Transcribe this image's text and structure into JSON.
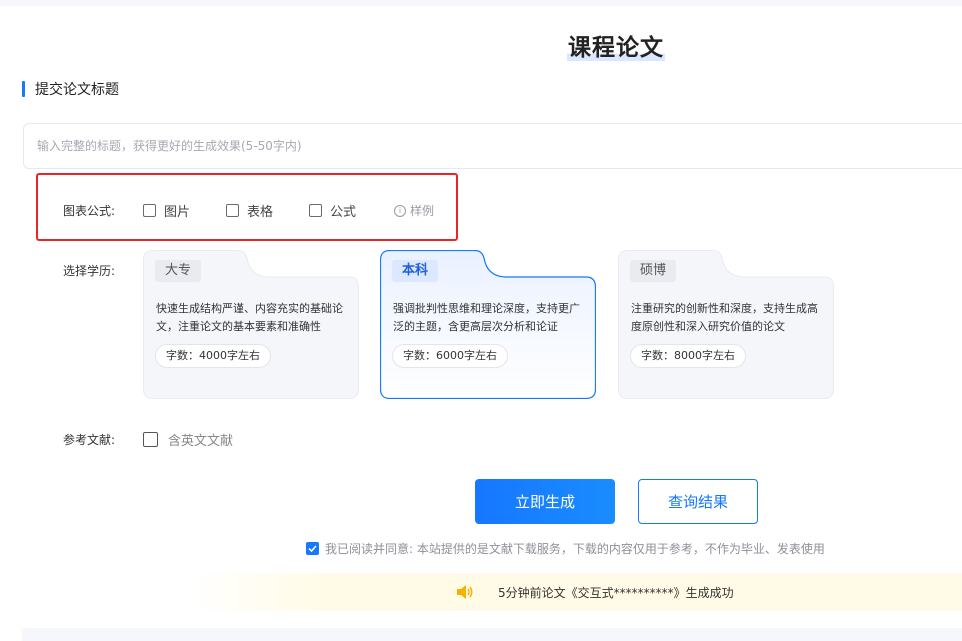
{
  "page": {
    "title": "课程论文"
  },
  "section": {
    "title": "提交论文标题"
  },
  "title_input": {
    "value": "",
    "placeholder": "输入完整的标题，获得更好的生成效果(5-50字内)"
  },
  "chart_options": {
    "label": "图表公式:",
    "items": [
      {
        "label": "图片",
        "checked": false
      },
      {
        "label": "表格",
        "checked": false
      },
      {
        "label": "公式",
        "checked": false
      }
    ],
    "sample_link": "样例",
    "info_icon_glyph": "i"
  },
  "education": {
    "label": "选择学历:",
    "cards": [
      {
        "tag": "大专",
        "desc": "快速生成结构严谨、内容充实的基础论文，注重论文的基本要素和准确性",
        "count": "字数：4000字左右",
        "selected": false
      },
      {
        "tag": "本科",
        "desc": "强调批判性思维和理论深度，支持更广泛的主题，含更高层次分析和论证",
        "count": "字数：6000字左右",
        "selected": true
      },
      {
        "tag": "硕博",
        "desc": "注重研究的创新性和深度，支持生成高度原创性和深入研究价值的论文",
        "count": "字数：8000字左右",
        "selected": false
      }
    ]
  },
  "references": {
    "label": "参考文献:",
    "option": "含英文文献",
    "checked": false
  },
  "buttons": {
    "generate": "立即生成",
    "query": "查询结果"
  },
  "agreement": {
    "text": "我已阅读并同意: 本站提供的是文献下载服务，下载的内容仅用于参考，不作为毕业、发表使用",
    "checked": true
  },
  "notice": {
    "text": "5分钟前论文《交互式**********》生成成功",
    "icon": "speaker-icon"
  },
  "colors": {
    "accent": "#1677ff",
    "highlight_border": "#e8262a",
    "notice_bg": "#fffbe6",
    "speaker": "#f5b301"
  }
}
